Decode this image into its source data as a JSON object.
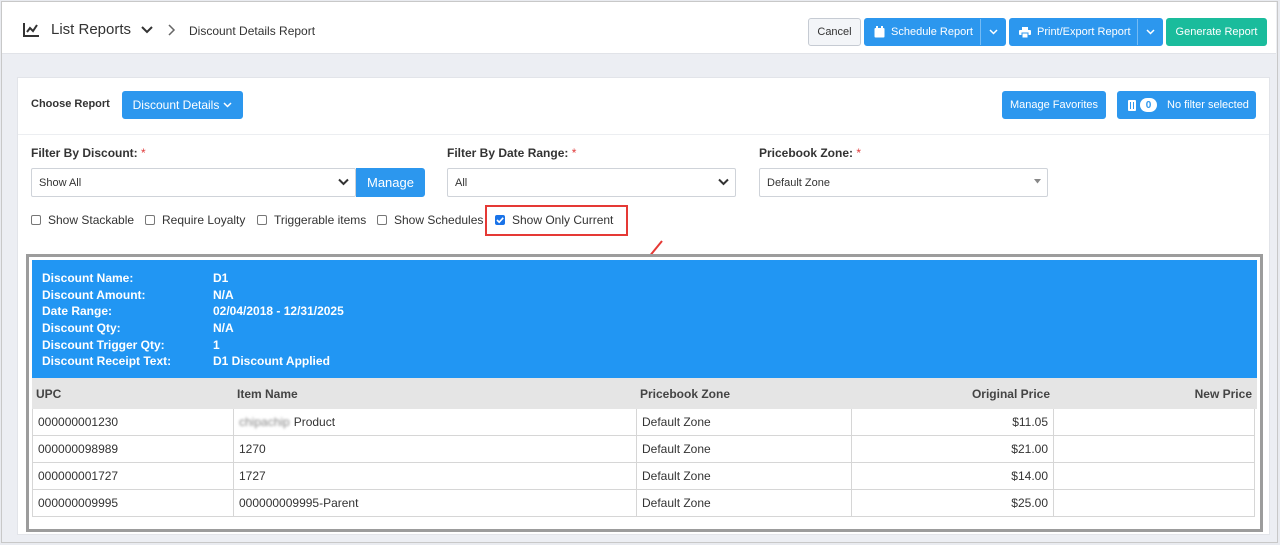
{
  "breadcrumb": {
    "icon": "line-chart-icon",
    "title": "List Reports",
    "current": "Discount Details Report"
  },
  "toolbar": {
    "cancel_label": "Cancel",
    "schedule_label": "Schedule Report",
    "print_label": "Print/Export Report",
    "generate_label": "Generate Report"
  },
  "report_picker": {
    "label": "Choose Report",
    "selected": "Discount Details",
    "favorites_label": "Manage Favorites",
    "filter_count": "0",
    "filter_label": "No filter selected"
  },
  "filters": {
    "discount": {
      "label": "Filter By Discount:",
      "required": "*",
      "value": "Show All",
      "manage_label": "Manage"
    },
    "date_range": {
      "label": "Filter By Date Range:",
      "required": "*",
      "value": "All"
    },
    "zone": {
      "label": "Pricebook Zone:",
      "required": "*",
      "value": "Default Zone"
    }
  },
  "checkboxes": [
    {
      "label": "Show Stackable",
      "checked": false
    },
    {
      "label": "Require Loyalty",
      "checked": false
    },
    {
      "label": "Triggerable items",
      "checked": false
    },
    {
      "label": "Show Schedules",
      "checked": false
    },
    {
      "label": "Show Only Current",
      "checked": true
    }
  ],
  "summary": [
    {
      "key": "Discount Name:",
      "value": "D1"
    },
    {
      "key": "Discount Amount:",
      "value": "N/A"
    },
    {
      "key": "Date Range:",
      "value": "02/04/2018 - 12/31/2025"
    },
    {
      "key": "Discount Qty:",
      "value": "N/A"
    },
    {
      "key": "Discount Trigger Qty:",
      "value": "1"
    },
    {
      "key": "Discount Receipt Text:",
      "value": "D1 Discount Applied"
    }
  ],
  "table": {
    "headers": [
      "UPC",
      "Item Name",
      "Pricebook Zone",
      "Original Price",
      "New Price"
    ],
    "rows": [
      {
        "upc": "000000001230",
        "item_blurred": "chipachip",
        "item": "Product",
        "zone": "Default Zone",
        "original": "$11.05",
        "new": ""
      },
      {
        "upc": "000000098989",
        "item_blurred": "",
        "item": "1270",
        "zone": "Default Zone",
        "original": "$21.00",
        "new": ""
      },
      {
        "upc": "000000001727",
        "item_blurred": "",
        "item": "1727",
        "zone": "Default Zone",
        "original": "$14.00",
        "new": ""
      },
      {
        "upc": "000000009995",
        "item_blurred": "",
        "item": "000000009995-Parent",
        "zone": "Default Zone",
        "original": "$25.00",
        "new": ""
      }
    ]
  },
  "colors": {
    "primary": "#2c97ee",
    "success": "#1abc9c",
    "summary_bg": "#2196f3",
    "highlight": "#e53935"
  }
}
